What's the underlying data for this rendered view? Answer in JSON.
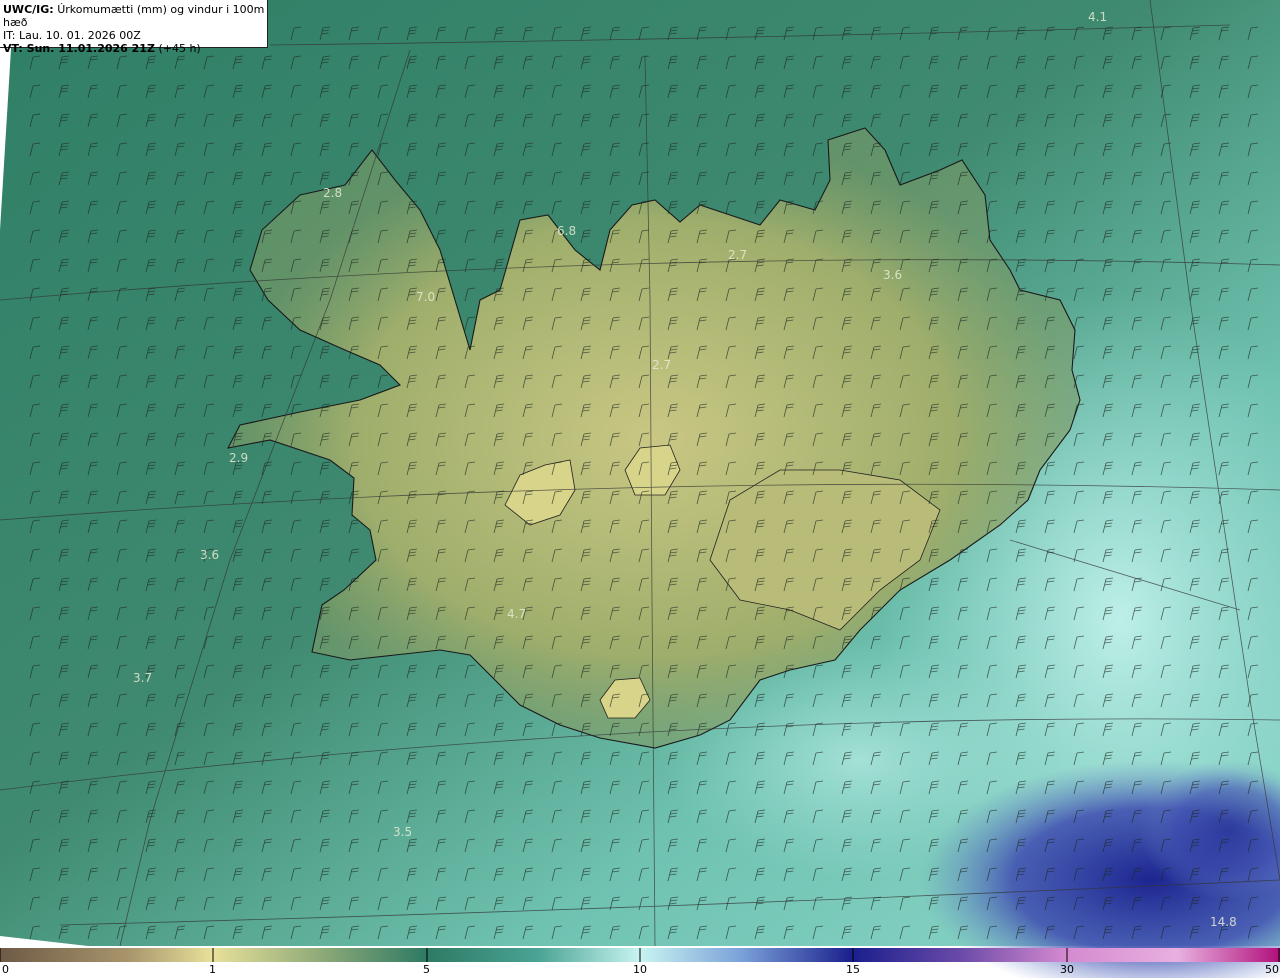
{
  "header": {
    "product_code": "UWC/IG:",
    "product_title": "Úrkomumætti (mm) og vindur i 100m hæð",
    "init_time": "IT: Lau. 10. 01. 2026 00Z",
    "valid_time": "VT: Sun. 11.01.2026 21Z",
    "lead_time": "(+45 h)"
  },
  "max_labels": [
    "4.1",
    "2.8",
    "6.8",
    "2.7",
    "3.6",
    "7.0",
    "2.7",
    "2.9",
    "3.6",
    "4.7",
    "3.7",
    "3.5",
    "14.8"
  ],
  "colorbar": {
    "ticks": [
      "0",
      "1",
      "5",
      "10",
      "15",
      "30",
      "50"
    ],
    "colors": [
      "#6e5a46",
      "#e8e09a",
      "#2e7a64",
      "#c8f4f0",
      "#1a1f8c",
      "#d58ad0",
      "#b0107a"
    ]
  },
  "map": {
    "wind_barb_icon": "wind-barb-icon",
    "coastline": "coastline",
    "land_color": "#a8b56e",
    "sea_color": "#2f7f66"
  }
}
